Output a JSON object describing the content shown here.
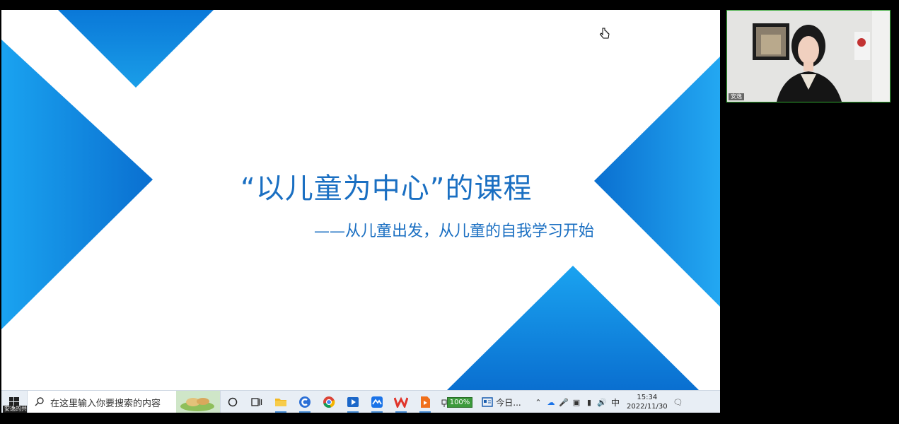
{
  "slide": {
    "title": "“以儿童为中心”的课程",
    "subtitle": "——从儿童出发，从儿童的自我学习开始"
  },
  "taskbar": {
    "share_label": "安逸的共享屏幕",
    "search_placeholder": "在这里输入你要搜索的内容",
    "battery": "100%",
    "news_label": "今日...",
    "ime": "中",
    "time": "15:34",
    "date": "2022/11/30"
  },
  "webcam": {
    "participant_name": "安逸"
  },
  "colors": {
    "slide_blue": "#1a6fc2",
    "shape_blue": "#0b8fe0",
    "taskbar_bg": "#e8eef5"
  }
}
